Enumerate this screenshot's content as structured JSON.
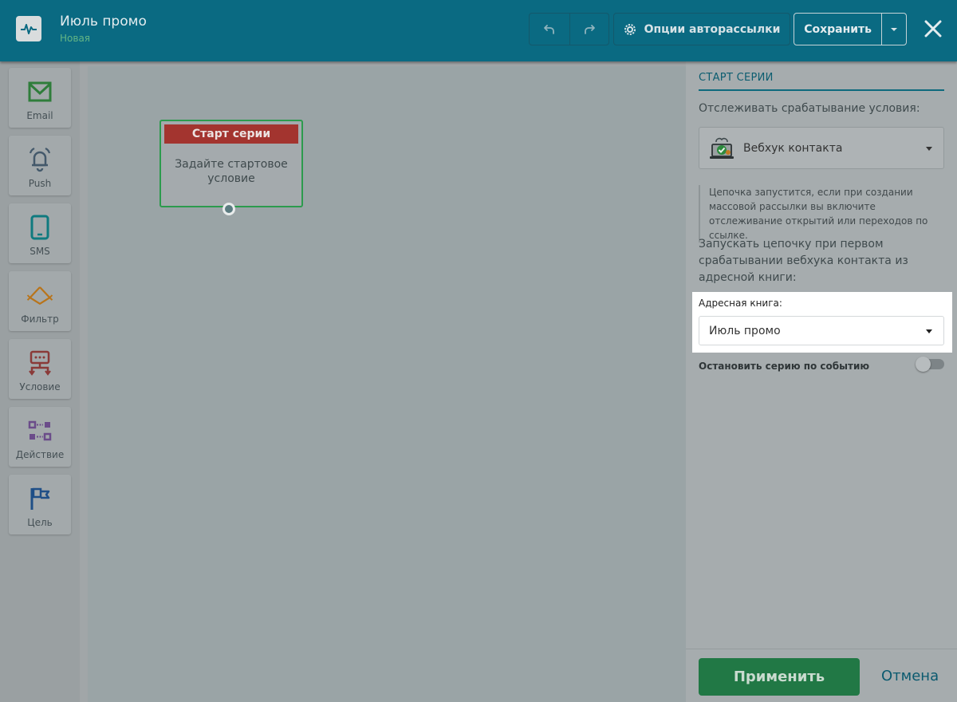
{
  "header": {
    "title": "Июль промо",
    "subtitle": "Новая",
    "options_label": "Опции авторассылки",
    "save_label": "Сохранить",
    "icons": {
      "logo": "pulse-icon",
      "undo": "undo-icon",
      "redo": "redo-icon",
      "options": "gear-icon",
      "caret": "caret-down-icon",
      "close": "close-icon"
    }
  },
  "sidebar": {
    "items": [
      {
        "label": "Email",
        "icon": "envelope-icon",
        "color": "#2f7d3b"
      },
      {
        "label": "Push",
        "icon": "bell-icon",
        "color": "#44596b"
      },
      {
        "label": "SMS",
        "icon": "phone-icon",
        "color": "#0f7a7f"
      },
      {
        "label": "Фильтр",
        "icon": "filter-icon",
        "color": "#b8741a"
      },
      {
        "label": "Условие",
        "icon": "condition-icon",
        "color": "#8a3a38"
      },
      {
        "label": "Действие",
        "icon": "action-icon",
        "color": "#6b4c8a"
      },
      {
        "label": "Цель",
        "icon": "flag-icon",
        "color": "#1f4f87"
      }
    ]
  },
  "canvas": {
    "node": {
      "title": "Старт серии",
      "body": "Задайте стартовое условие"
    }
  },
  "panel": {
    "title": "СТАРТ СЕРИИ",
    "track_label": "Отслеживать срабатывание условия:",
    "webhook_value": "Вебхук контакта",
    "webhook_icon": "laptop-check-icon",
    "note": "Цепочка запустится, если при создании массовой рассылки вы включите отслеживание открытий или переходов по ссылке.",
    "launch_text": "Запускать цепочку при первом срабатывании вебхука контакта из адресной книги:",
    "addressbook_label": "Адресная книга:",
    "addressbook_value": "Июль промо",
    "stop_label": "Остановить серию по событию",
    "stop_enabled": false,
    "apply_label": "Применить",
    "cancel_label": "Отмена"
  }
}
